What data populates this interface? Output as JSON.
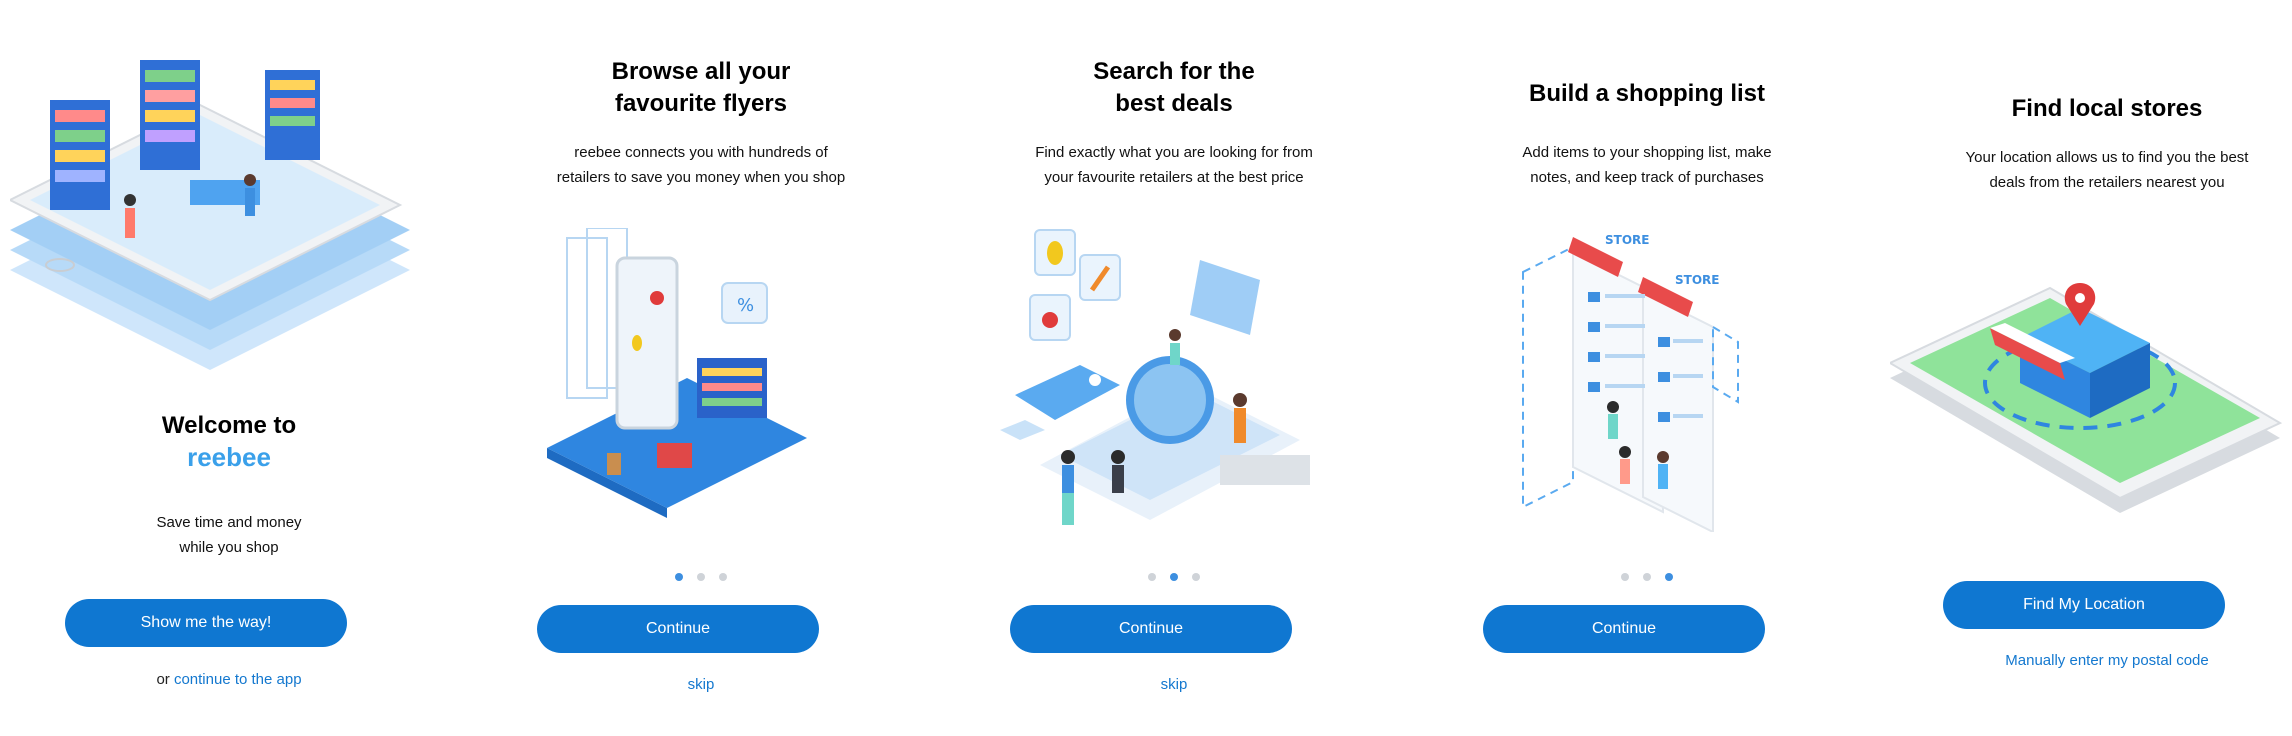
{
  "panels": [
    {
      "title_line1": "Welcome to",
      "brand": "reebee",
      "desc_line1": "Save time and money",
      "desc_line2": "while you shop",
      "button": "Show me the way!",
      "link_prefix": "or",
      "link": "continue to the app",
      "illustration": "isometric-phone-store-icon"
    },
    {
      "title_line1": "Browse all your",
      "title_line2": "favourite flyers",
      "desc_line1": "reebee connects you with hundreds of",
      "desc_line2": "retailers to save you money when you shop",
      "button": "Continue",
      "link": "skip",
      "active_dot": 0,
      "illustration": "flyers-phone-icon"
    },
    {
      "title_line1": "Search for the",
      "title_line2": "best deals",
      "desc_line1": "Find exactly what you are looking for from",
      "desc_line2": "your favourite retailers at the best price",
      "button": "Continue",
      "link": "skip",
      "active_dot": 1,
      "illustration": "magnifier-deals-icon"
    },
    {
      "title_line1": "Build a shopping list",
      "desc_line1": "Add items to your shopping list, make",
      "desc_line2": "notes, and keep track of purchases",
      "button": "Continue",
      "active_dot": 2,
      "illustration": "shopping-list-icon",
      "store_label_1": "STORE",
      "store_label_2": "STORE"
    },
    {
      "title_line1": "Find local stores",
      "desc_line1": "Your location allows us to find you the best",
      "desc_line2": "deals from the retailers nearest you",
      "button": "Find My Location",
      "link": "Manually enter my postal code",
      "illustration": "location-store-icon"
    }
  ],
  "colors": {
    "accent": "#0f77d1",
    "link": "#1478cf",
    "brand": "#3aa0ea",
    "dot_active": "#3d8fe0",
    "dot": "#cfd3d8"
  }
}
